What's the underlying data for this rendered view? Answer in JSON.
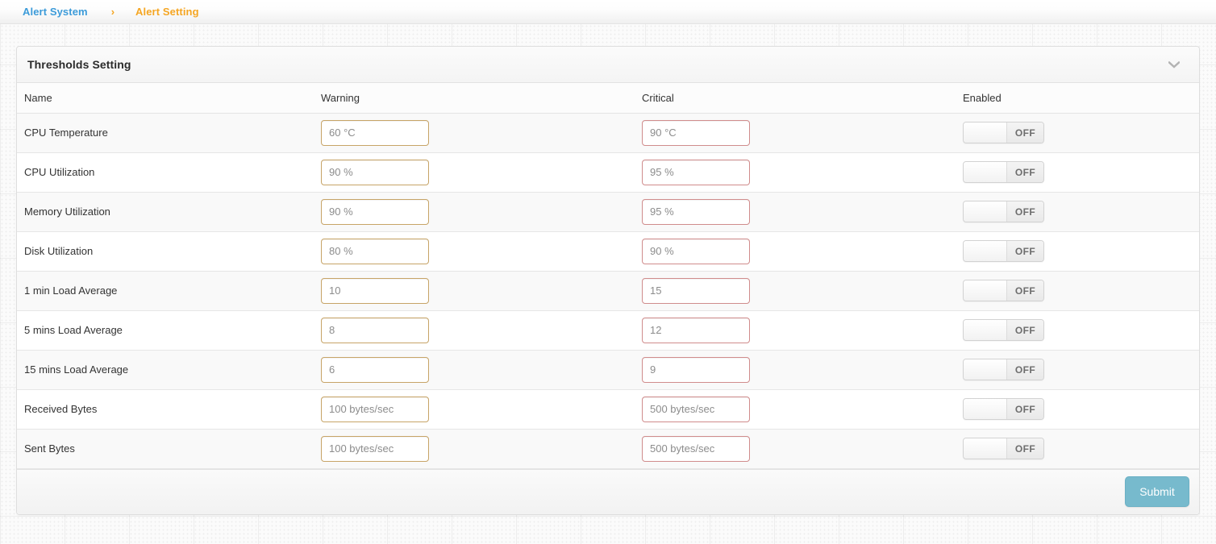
{
  "breadcrumb": {
    "root": "Alert System",
    "separator": "›",
    "current": "Alert Setting"
  },
  "panel": {
    "title": "Thresholds Setting",
    "collapse_icon": "chevron-down-icon"
  },
  "table": {
    "columns": [
      "Name",
      "Warning",
      "Critical",
      "Enabled"
    ],
    "rows": [
      {
        "name": "CPU Temperature",
        "warning": "60 °C",
        "critical": "90 °C",
        "enabled": "OFF"
      },
      {
        "name": "CPU Utilization",
        "warning": "90 %",
        "critical": "95 %",
        "enabled": "OFF"
      },
      {
        "name": "Memory Utilization",
        "warning": "90 %",
        "critical": "95 %",
        "enabled": "OFF"
      },
      {
        "name": "Disk Utilization",
        "warning": "80 %",
        "critical": "90 %",
        "enabled": "OFF"
      },
      {
        "name": "1 min Load Average",
        "warning": "10",
        "critical": "15",
        "enabled": "OFF"
      },
      {
        "name": "5 mins Load Average",
        "warning": "8",
        "critical": "12",
        "enabled": "OFF"
      },
      {
        "name": "15 mins Load Average",
        "warning": "6",
        "critical": "9",
        "enabled": "OFF"
      },
      {
        "name": "Received Bytes",
        "warning": "100 bytes/sec",
        "critical": "500 bytes/sec",
        "enabled": "OFF"
      },
      {
        "name": "Sent Bytes",
        "warning": "100 bytes/sec",
        "critical": "500 bytes/sec",
        "enabled": "OFF"
      }
    ]
  },
  "footer": {
    "submit_label": "Submit"
  },
  "colors": {
    "breadcrumb_root": "#3c9bd9",
    "breadcrumb_current": "#f5a623",
    "warning_border": "#c7a467",
    "critical_border": "#d08c8c",
    "submit_bg": "#77bacd"
  }
}
